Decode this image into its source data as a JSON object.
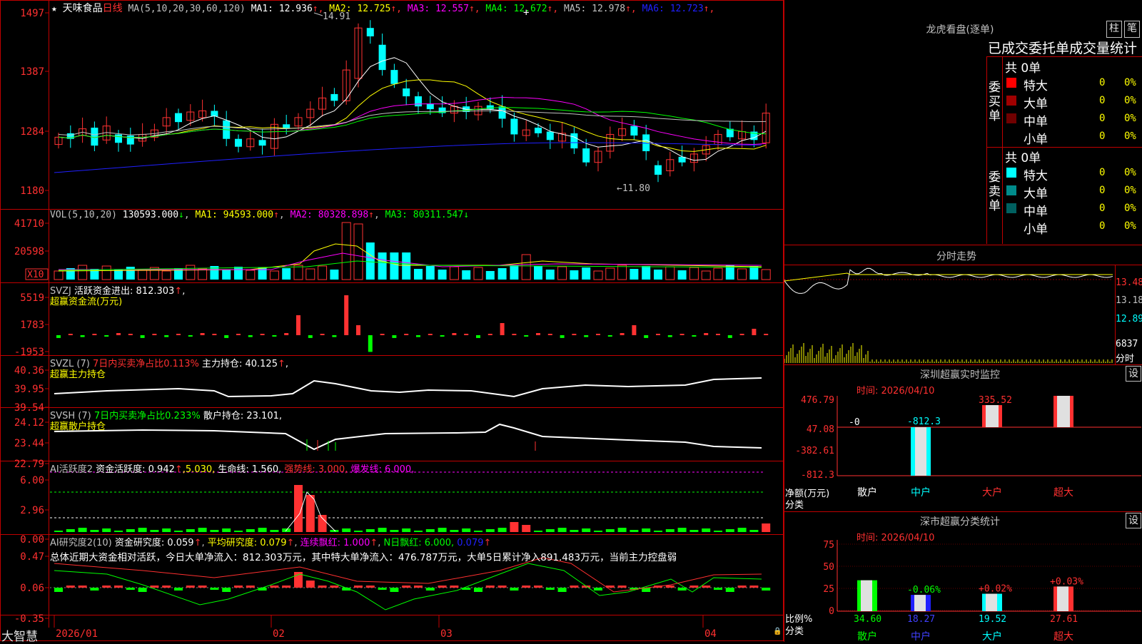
{
  "stock": {
    "name": "天味食品",
    "period": "日线",
    "star": "★"
  },
  "app_logo": "大智慧",
  "kline_panel": {
    "ma_header": "MA(5,10,20,30,60,120)",
    "ma": [
      {
        "label": "MA1:",
        "value": "12.936",
        "arrow": "↑",
        "color": "#ffffff"
      },
      {
        "label": "MA2:",
        "value": "12.725",
        "arrow": "↑",
        "color": "#ffff00"
      },
      {
        "label": "MA3:",
        "value": "12.557",
        "arrow": "↑",
        "color": "#ff00ff"
      },
      {
        "label": "MA4:",
        "value": "12.672",
        "arrow": "↑",
        "color": "#00ff00"
      },
      {
        "label": "MA5:",
        "value": "12.978",
        "arrow": "↑",
        "color": "#c0c0c0"
      },
      {
        "label": "MA6:",
        "value": "12.723",
        "arrow": "↑",
        "color": "#2020ff"
      }
    ],
    "y_labels": [
      "1497",
      "1387",
      "1284",
      "1180"
    ],
    "high_marker": "14.91",
    "low_marker": "11.80"
  },
  "vol_panel": {
    "header": "VOL(5,10,20)",
    "value": "130593.000",
    "value_arrow": "↓",
    "ma1": "MA1: 94593.000",
    "ma1_arrow": "↑",
    "ma2": "MA2: 80328.898",
    "ma2_arrow": "↑",
    "ma3": "MA3: 80311.547",
    "ma3_arrow": "↓",
    "y_labels": [
      "41710",
      "20598"
    ],
    "unit": "X10"
  },
  "svzj_panel": {
    "header": "SVZJ",
    "label": "活跃资金进出: 812.303",
    "arrow": "↑",
    "suffix": ",",
    "subtitle": "超赢资金流(万元)",
    "y_labels": [
      "5519",
      "1783",
      "-1953"
    ]
  },
  "svzl_panel": {
    "header": "SVZL (7)",
    "ratio": "7日内买卖净占比0.113%",
    "label": "主力持仓: 40.125",
    "arrow": "↑",
    "suffix": ",",
    "subtitle": "超赢主力持仓",
    "y_labels": [
      "40.36",
      "39.95",
      "39.54"
    ]
  },
  "svsh_panel": {
    "header": "SVSH (7)",
    "ratio": "7日内买卖净占比0.233%",
    "label": "散户持仓: 23.101,",
    "subtitle": "超赢散户持仓",
    "y_labels": [
      "24.12",
      "23.44",
      "22.79"
    ]
  },
  "ai_active_panel": {
    "header": "AI活跃度2",
    "label": "资金活跃度: 0.942",
    "arrow": "↑",
    "v2": ",5.030,",
    "life": "生命线: 1.560,",
    "strong": "强势线: 3.000,",
    "burst": "爆发线: 6.000,",
    "y_labels": [
      "6.00",
      "2.96",
      "0.00"
    ]
  },
  "ai_research_panel": {
    "header": "AI研究度2(10)",
    "label": "资金研究度: 0.059",
    "avg": "平均研究度: 0.079",
    "cont": "连续飘红: 1.000",
    "nday": "N日飘红: 6.000,",
    "extra": "0.079",
    "summary": "总体近期大资金相对活跃，今日大单净流入：812.303万元，其中特大单净流入：476.787万元，大单5日累计净入891.483万元，当前主力控盘弱",
    "y_labels": [
      "0.47",
      "0.06",
      "-0.35"
    ]
  },
  "x_axis": {
    "dates": [
      "2026/01",
      "02",
      "03",
      "04"
    ]
  },
  "dragon_tiger": {
    "title": "龙虎看盘(逐单)",
    "btn_bar": "柱",
    "btn_tick": "笔",
    "subtitle": "已成交委托单成交量统计",
    "buy": {
      "side": "委买单",
      "count": "共 0单",
      "rows": [
        {
          "label": "特大",
          "num": "0",
          "pct": "0%",
          "color": "#ff0000"
        },
        {
          "label": "大单",
          "num": "0",
          "pct": "0%",
          "color": "#a00000"
        },
        {
          "label": "中单",
          "num": "0",
          "pct": "0%",
          "color": "#700000"
        },
        {
          "label": "小单",
          "num": "0",
          "pct": "0%",
          "color": "#000000"
        }
      ]
    },
    "sell": {
      "side": "委卖单",
      "count": "共 0单",
      "rows": [
        {
          "label": "特大",
          "num": "0",
          "pct": "0%",
          "color": "#00ffff"
        },
        {
          "label": "大单",
          "num": "0",
          "pct": "0%",
          "color": "#008b8b"
        },
        {
          "label": "中单",
          "num": "0",
          "pct": "0%",
          "color": "#006060"
        },
        {
          "label": "小单",
          "num": "0",
          "pct": "0%",
          "color": "#000000"
        }
      ]
    }
  },
  "intraday": {
    "title": "分时走势",
    "prices": [
      "13.48",
      "13.18",
      "12.89"
    ],
    "volume": "6837",
    "unit": "分时"
  },
  "sz_monitor": {
    "title": "深圳超赢实时监控",
    "btn": "设",
    "time": "时间: 2026/04/10",
    "y_labels": [
      "476.79",
      "47.08",
      "-382.61",
      "-812.3"
    ],
    "y_caption": "净额(万元)",
    "x_caption": "分类",
    "categories": [
      "散户",
      "中户",
      "大户",
      "超大"
    ],
    "values": [
      0,
      -812.3,
      335.52,
      476.79
    ],
    "value_labels": [
      "-0",
      "-812.3",
      "335.52",
      "476.79"
    ]
  },
  "sz_classify": {
    "title": "深市超赢分类统计",
    "btn": "设",
    "time": "时间: 2026/04/10",
    "y_labels": [
      "75",
      "50",
      "25",
      "0"
    ],
    "y_caption": "比例%",
    "x_caption": "分类",
    "categories": [
      "散户",
      "中户",
      "大户",
      "超大"
    ],
    "values": [
      34.6,
      18.27,
      19.52,
      27.61
    ],
    "deltas": [
      "",
      "-0.06%",
      "+0.02%",
      "+0.03%"
    ],
    "value_labels": [
      "34.60",
      "18.27",
      "19.52",
      "27.61"
    ]
  }
}
